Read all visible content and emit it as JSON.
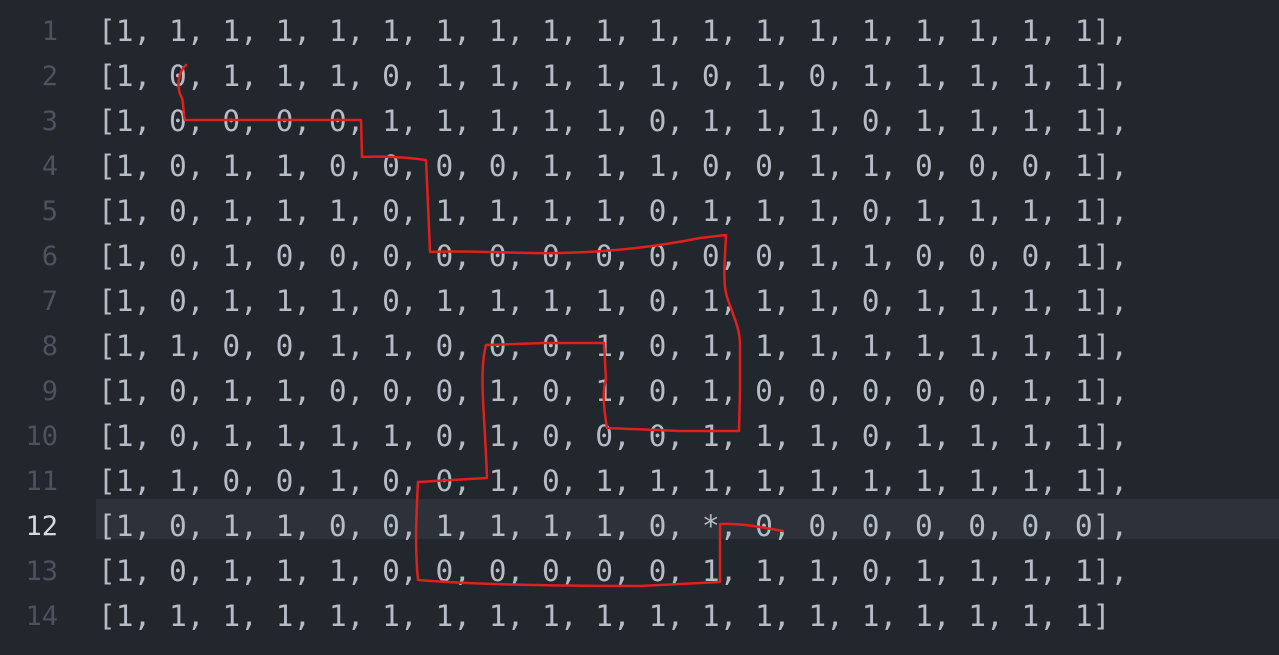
{
  "editor": {
    "current_line": 12,
    "lines": [
      {
        "num": "1",
        "text": "[1, 1, 1, 1, 1, 1, 1, 1, 1, 1, 1, 1, 1, 1, 1, 1, 1, 1, 1],"
      },
      {
        "num": "2",
        "text": "[1, 0, 1, 1, 1, 0, 1, 1, 1, 1, 1, 0, 1, 0, 1, 1, 1, 1, 1],"
      },
      {
        "num": "3",
        "text": "[1, 0, 0, 0, 0, 1, 1, 1, 1, 1, 0, 1, 1, 1, 0, 1, 1, 1, 1],"
      },
      {
        "num": "4",
        "text": "[1, 0, 1, 1, 0, 0, 0, 0, 1, 1, 1, 0, 0, 1, 1, 0, 0, 0, 1],"
      },
      {
        "num": "5",
        "text": "[1, 0, 1, 1, 1, 0, 1, 1, 1, 1, 0, 1, 1, 1, 0, 1, 1, 1, 1],"
      },
      {
        "num": "6",
        "text": "[1, 0, 1, 0, 0, 0, 0, 0, 0, 0, 0, 0, 0, 1, 1, 0, 0, 0, 1],"
      },
      {
        "num": "7",
        "text": "[1, 0, 1, 1, 1, 0, 1, 1, 1, 1, 0, 1, 1, 1, 0, 1, 1, 1, 1],"
      },
      {
        "num": "8",
        "text": "[1, 1, 0, 0, 1, 1, 0, 0, 0, 1, 0, 1, 1, 1, 1, 1, 1, 1, 1],"
      },
      {
        "num": "9",
        "text": "[1, 0, 1, 1, 0, 0, 0, 1, 0, 1, 0, 1, 0, 0, 0, 0, 0, 1, 1],"
      },
      {
        "num": "10",
        "text": "[1, 0, 1, 1, 1, 1, 0, 1, 0, 0, 0, 1, 1, 1, 0, 1, 1, 1, 1],"
      },
      {
        "num": "11",
        "text": "[1, 1, 0, 0, 1, 0, 0, 1, 0, 1, 1, 1, 1, 1, 1, 1, 1, 1, 1],"
      },
      {
        "num": "12",
        "text": "[1, 0, 1, 1, 0, 0, 1, 1, 1, 1, 0, *, 0, 0, 0, 0, 0, 0, 0],"
      },
      {
        "num": "13",
        "text": "[1, 0, 1, 1, 1, 0, 0, 0, 0, 0, 0, 1, 1, 1, 0, 1, 1, 1, 1],"
      },
      {
        "num": "14",
        "text": "[1, 1, 1, 1, 1, 1, 1, 1, 1, 1, 1, 1, 1, 1, 1, 1, 1, 1, 1]"
      }
    ]
  },
  "annotation": {
    "stroke_color": "#e0201c",
    "description_icon": "hand-drawn-path"
  },
  "theme": {
    "background": "#22262d",
    "current_line_bg": "#2c313a",
    "text": "#b6bcc6",
    "gutter_text": "#4c535e",
    "gutter_current": "#d6dae0"
  }
}
